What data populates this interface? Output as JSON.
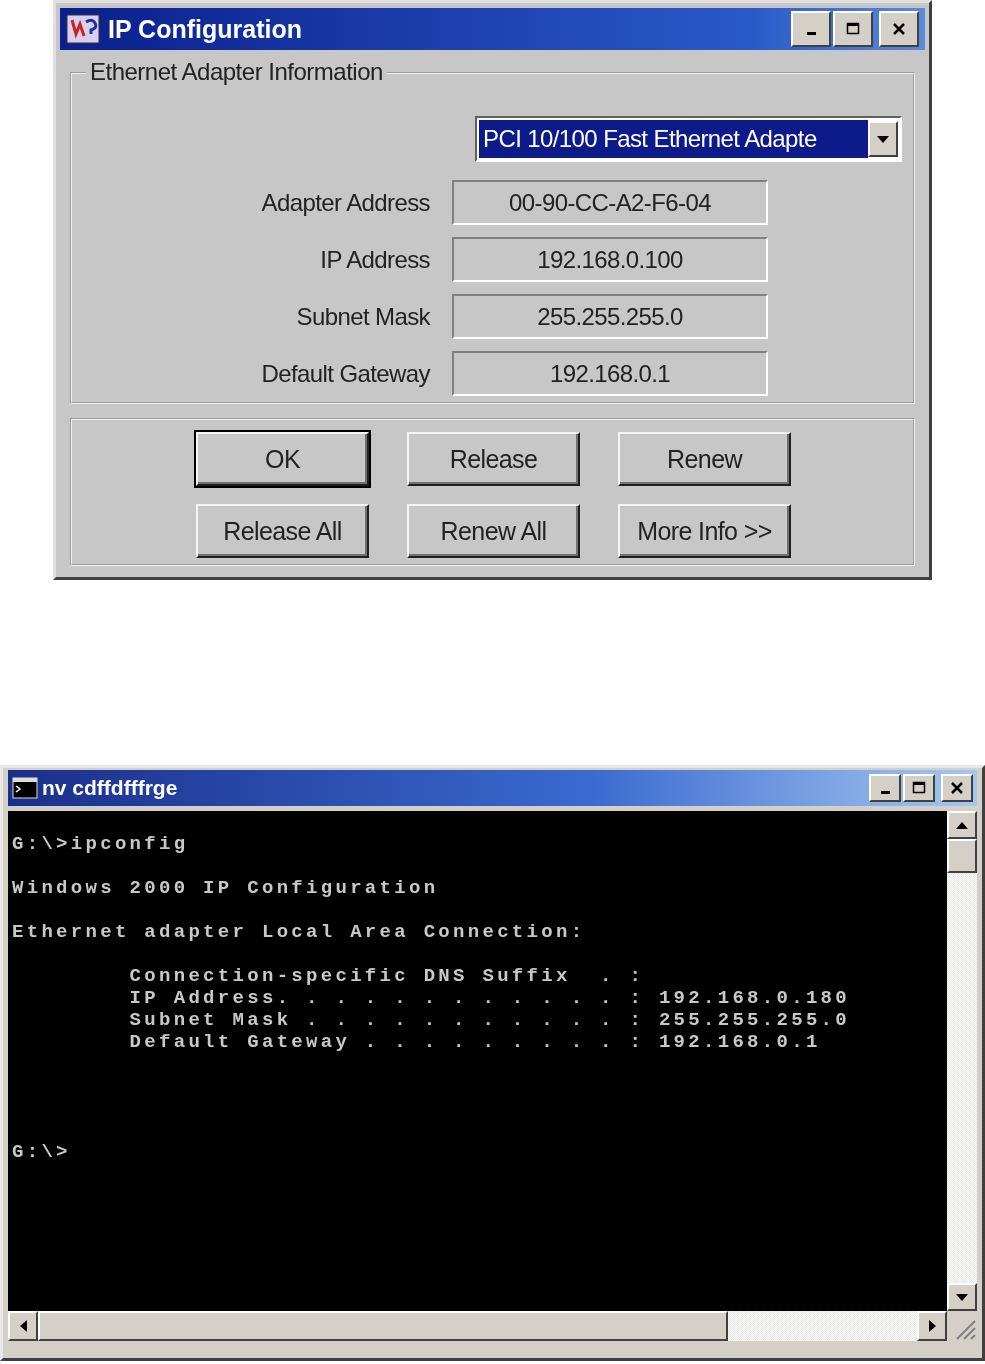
{
  "ip_dialog": {
    "title": "IP Configuration",
    "group_title": "Ethernet  Adapter Information",
    "adapter_dropdown": {
      "value": "PCI 10/100 Fast Ethernet Adapte",
      "selected": true
    },
    "fields": [
      {
        "label": "Adapter Address",
        "value": "00-90-CC-A2-F6-04"
      },
      {
        "label": "IP Address",
        "value": "192.168.0.100"
      },
      {
        "label": "Subnet Mask",
        "value": "255.255.255.0"
      },
      {
        "label": "Default Gateway",
        "value": "192.168.0.1"
      }
    ],
    "buttons": [
      {
        "label": "OK",
        "default": true
      },
      {
        "label": "Release",
        "default": false
      },
      {
        "label": "Renew",
        "default": false
      },
      {
        "label": "Release All",
        "default": false
      },
      {
        "label": "Renew All",
        "default": false
      },
      {
        "label": "More Info >>",
        "default": false
      }
    ]
  },
  "console": {
    "title": "nv cdffdfffrge",
    "output_blocks": [
      [
        "G:\\>ipconfig"
      ],
      [
        "Windows 2000 IP Configuration"
      ],
      [
        "Ethernet adapter Local Area Connection:"
      ],
      [
        "        Connection-specific DNS Suffix  . :",
        "        IP Address. . . . . . . . . . . . : 192.168.0.180",
        "        Subnet Mask . . . . . . . . . . . : 255.255.255.0",
        "        Default Gateway . . . . . . . . . : 192.168.0.1"
      ]
    ],
    "prompt": "G:\\>"
  }
}
